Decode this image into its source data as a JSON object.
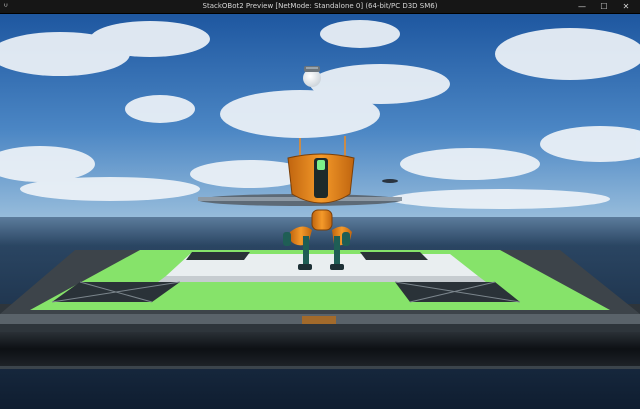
{
  "window": {
    "title": "StackOBot2 Preview [NetMode: Standalone 0]  (64-bit/PC D3D SM6)",
    "app_icon": "unreal-engine-icon",
    "controls": {
      "minimize": "—",
      "maximize": "☐",
      "close": "✕"
    }
  },
  "colors": {
    "titlebar": "#161616",
    "sky_top": "#1f5aa3",
    "sky_horizon": "#8db4d8",
    "ocean": "#1a2e48",
    "platform_green": "#86e36a",
    "robot_orange": "#f08a1e"
  }
}
